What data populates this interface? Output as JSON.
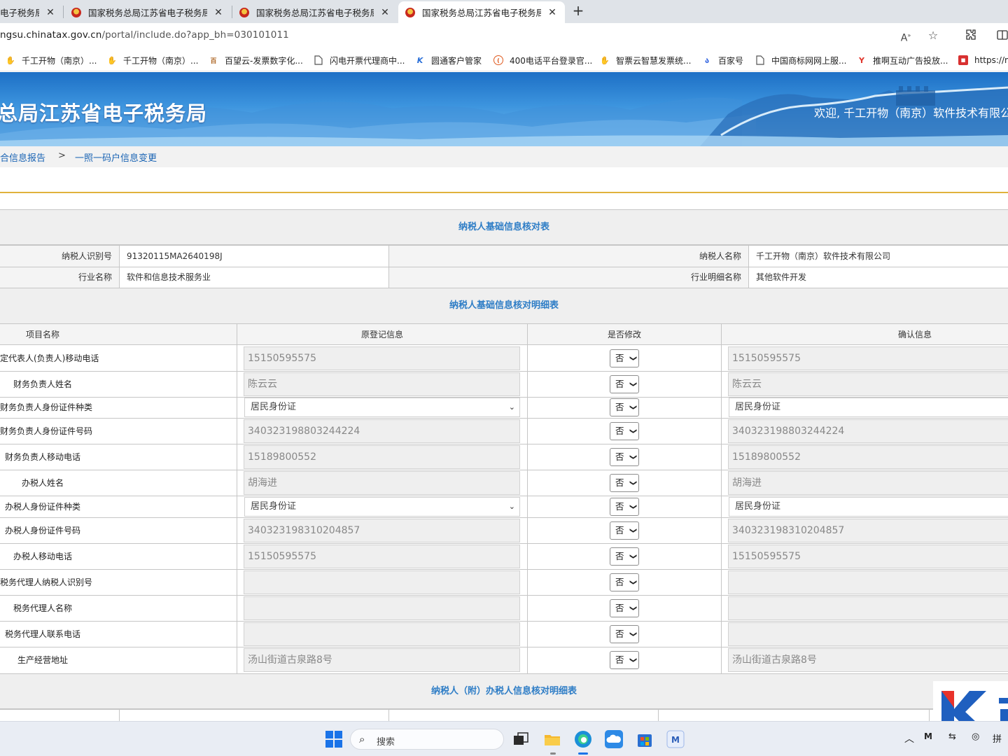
{
  "browser": {
    "tabs": [
      {
        "title": "电子税务局",
        "close": "✕"
      },
      {
        "title": "国家税务总局江苏省电子税务局",
        "close": "✕"
      },
      {
        "title": "国家税务总局江苏省电子税务局",
        "close": "✕"
      },
      {
        "title": "国家税务总局江苏省电子税务局",
        "close": "✕"
      }
    ],
    "new_tab": "+",
    "url_host": "ngsu.chinatax.gov.cn",
    "url_path": "/portal/include.do?app_bh=030101011",
    "bookmarks": [
      {
        "label": "千工开物（南京）...",
        "icon": "hand-logo",
        "color": "#2f7fd6"
      },
      {
        "label": "千工开物（南京）...",
        "icon": "hand-logo",
        "color": "#2f7fd6"
      },
      {
        "label": "百望云-发票数字化...",
        "icon": "baiwang-logo",
        "color": "#b06a2a"
      },
      {
        "label": "闪电开票代理商中...",
        "icon": "page-icon",
        "color": "#555555"
      },
      {
        "label": "圆通客户管家",
        "icon": "k-logo",
        "color": "#2a6fd8"
      },
      {
        "label": "400电话平台登录官...",
        "icon": "phone-logo",
        "color": "#e05a1f"
      },
      {
        "label": "智票云智慧发票统...",
        "icon": "hand-logo",
        "color": "#2f7fd6"
      },
      {
        "label": "百家号",
        "icon": "baijiahao-logo",
        "color": "#2b5fe0"
      },
      {
        "label": "中国商标网网上服...",
        "icon": "page-icon",
        "color": "#555555"
      },
      {
        "label": "推啊互动广告投放...",
        "icon": "tuia-logo",
        "color": "#e0352b"
      },
      {
        "label": "https://m",
        "icon": "red-logo",
        "color": "#d83030"
      }
    ]
  },
  "banner": {
    "title": "总局江苏省电子税务局",
    "welcome": "欢迎, 千工开物（南京）软件技术有限公"
  },
  "breadcrumb": {
    "parent": "合信息报告",
    "separator": ">",
    "current": "一照一码户信息变更"
  },
  "basic_info": {
    "title": "纳税人基础信息核对表",
    "rows": [
      {
        "label1": "纳税人识别号",
        "value1": "91320115MA2640198J",
        "label2": "纳税人名称",
        "value2": "千工开物（南京）软件技术有限公司"
      },
      {
        "label1": "行业名称",
        "value1": "软件和信息技术服务业",
        "label2": "行业明细名称",
        "value2": "其他软件开发"
      }
    ]
  },
  "detail": {
    "title": "纳税人基础信息核对明细表",
    "headers": [
      "项目名称",
      "原登记信息",
      "是否修改",
      "确认信息"
    ],
    "rows": [
      {
        "label": "定代表人(负责人)移动电话",
        "original": "15150595575",
        "kind": "input",
        "modify": "否",
        "confirmed": "15150595575"
      },
      {
        "label": "财务负责人姓名",
        "original": "陈云云",
        "kind": "input",
        "modify": "否",
        "confirmed": "陈云云"
      },
      {
        "label": "财务负责人身份证件种类",
        "original": "居民身份证",
        "kind": "select",
        "modify": "否",
        "confirmed": "居民身份证"
      },
      {
        "label": "财务负责人身份证件号码",
        "original": "340323198803244224",
        "kind": "input",
        "modify": "否",
        "confirmed": "340323198803244224"
      },
      {
        "label": "财务负责人移动电话",
        "original": "15189800552",
        "kind": "input",
        "modify": "否",
        "confirmed": "15189800552"
      },
      {
        "label": "办税人姓名",
        "original": "胡海进",
        "kind": "input",
        "modify": "否",
        "confirmed": "胡海进"
      },
      {
        "label": "办税人身份证件种类",
        "original": "居民身份证",
        "kind": "select",
        "modify": "否",
        "confirmed": "居民身份证"
      },
      {
        "label": "办税人身份证件号码",
        "original": "340323198310204857",
        "kind": "input",
        "modify": "否",
        "confirmed": "340323198310204857"
      },
      {
        "label": "办税人移动电话",
        "original": "15150595575",
        "kind": "input",
        "modify": "否",
        "confirmed": "15150595575"
      },
      {
        "label": "税务代理人纳税人识别号",
        "original": "",
        "kind": "input",
        "modify": "否",
        "confirmed": ""
      },
      {
        "label": "税务代理人名称",
        "original": "",
        "kind": "input",
        "modify": "否",
        "confirmed": ""
      },
      {
        "label": "税务代理人联系电话",
        "original": "",
        "kind": "input",
        "modify": "否",
        "confirmed": ""
      },
      {
        "label": "生产经营地址",
        "original": "汤山街道古泉路8号",
        "kind": "input",
        "modify": "否",
        "confirmed": "汤山街道古泉路8号"
      }
    ]
  },
  "attached": {
    "title": "纳税人（附）办税人信息核对明细表"
  },
  "taskbar": {
    "search_label": "搜索",
    "tray_ime": "拼"
  }
}
